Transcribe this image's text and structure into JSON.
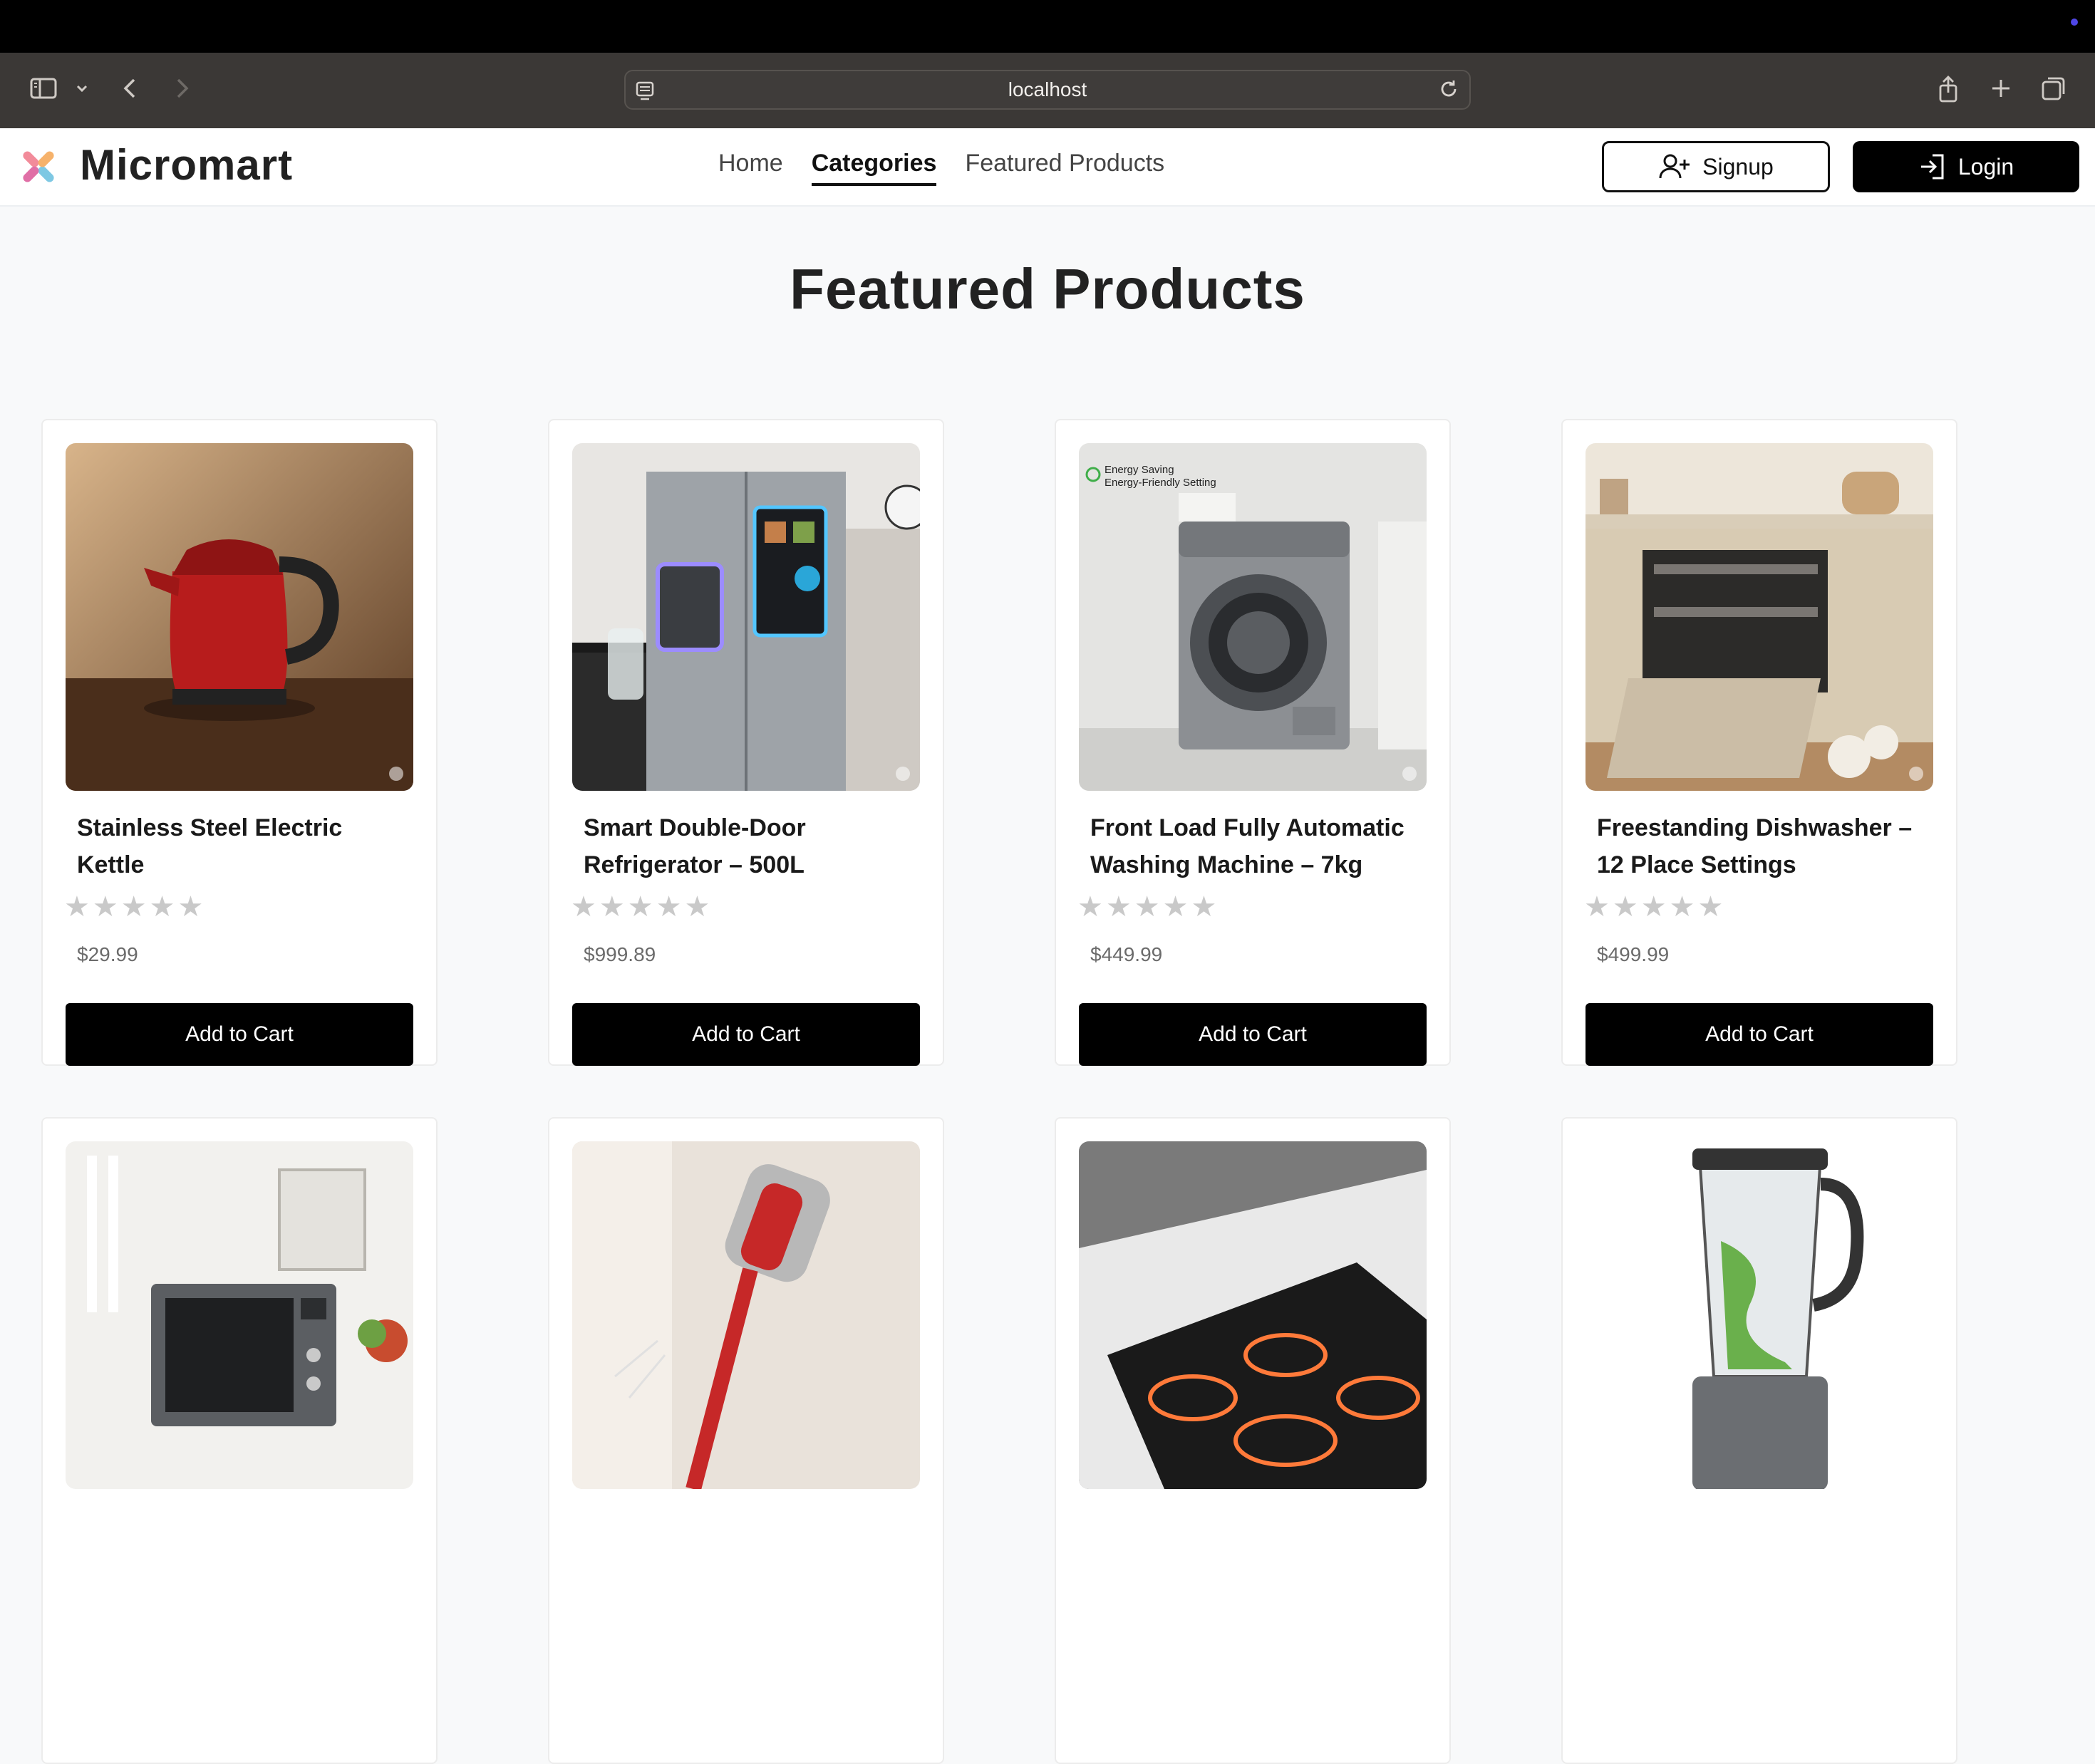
{
  "browser": {
    "url": "localhost",
    "icons": {
      "sidebar": "sidebar-icon",
      "tab_group": "chevron-down-icon",
      "back": "chevron-left-icon",
      "forward": "chevron-right-icon",
      "reload": "reload-icon",
      "share": "share-icon",
      "new_tab": "plus-icon",
      "tabs_overview": "tabs-icon"
    }
  },
  "header": {
    "logo_text": "Micromart",
    "nav": [
      {
        "label": "Home",
        "active": false
      },
      {
        "label": "Categories",
        "active": true
      },
      {
        "label": "Featured Products",
        "active": false
      }
    ],
    "signup_label": "Signup",
    "login_label": "Login"
  },
  "main": {
    "section_title": "Featured Products",
    "products": [
      {
        "title": "Stainless Steel Electric Kettle",
        "price": "$29.99",
        "rating": 0,
        "button": "Add to Cart",
        "image": "red electric kettle"
      },
      {
        "title": "Smart Double-Door Refrigerator – 500L",
        "price": "$999.89",
        "rating": 0,
        "button": "Add to Cart",
        "image": "double-door refrigerator"
      },
      {
        "title": "Front Load Fully Automatic Washing Machine – 7kg",
        "price": "$449.99",
        "rating": 0,
        "button": "Add to Cart",
        "image": "front load washing machine",
        "image_text": [
          "Energy Saving",
          "Energy-Friendly Setting"
        ]
      },
      {
        "title": "Freestanding Dishwasher – 12 Place Settings",
        "price": "$499.99",
        "rating": 0,
        "button": "Add to Cart",
        "image": "open dishwasher in kitchen"
      },
      {
        "image": "microwave oven"
      },
      {
        "image": "cordless vacuum cleaner"
      },
      {
        "image": "induction cooktop"
      },
      {
        "image": "blender"
      }
    ]
  },
  "colors": {
    "accent": "#000000",
    "page_bg": "#f8f9fa",
    "browser_bar": "#3b3836",
    "star_empty": "#c9c9c9"
  }
}
